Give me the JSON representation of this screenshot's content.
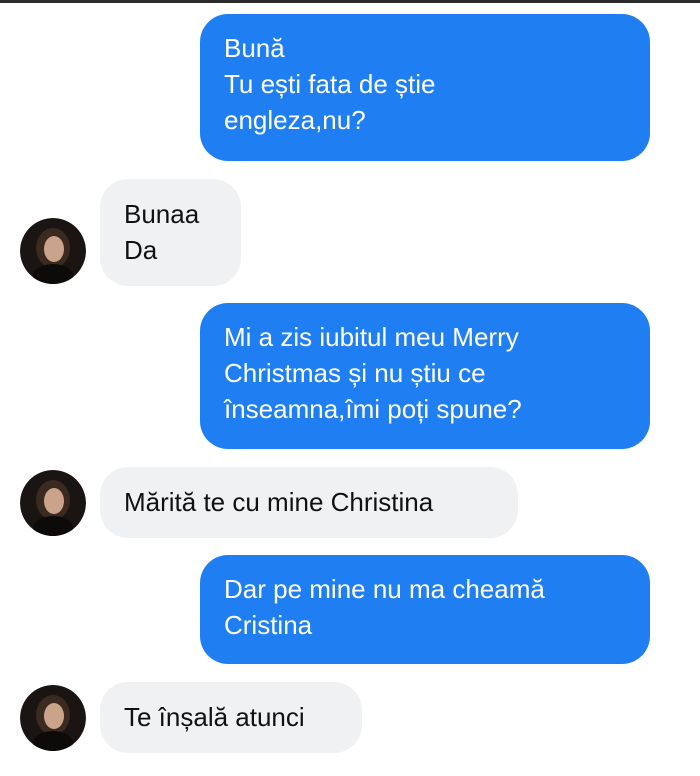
{
  "conversation": {
    "messages": [
      {
        "sender": "me",
        "text": "Bună\nTu ești fata de știe\nengleza,nu?"
      },
      {
        "sender": "contact",
        "text": "Bunaa\nDa"
      },
      {
        "sender": "me",
        "text": "Mi a zis iubitul meu Merry\nChristmas și nu știu ce\nînseamna,îmi poți spune?"
      },
      {
        "sender": "contact",
        "text": "Mărită te cu mine Christina"
      },
      {
        "sender": "me",
        "text": "Dar pe mine nu ma cheamă\nCristina"
      },
      {
        "sender": "contact",
        "text": "Te înșală atunci"
      }
    ]
  },
  "colors": {
    "sent_bubble": "#1f7ff2",
    "received_bubble": "#f0f1f3",
    "background": "#ffffff"
  },
  "icons": {
    "avatar": "contact-profile-photo"
  }
}
